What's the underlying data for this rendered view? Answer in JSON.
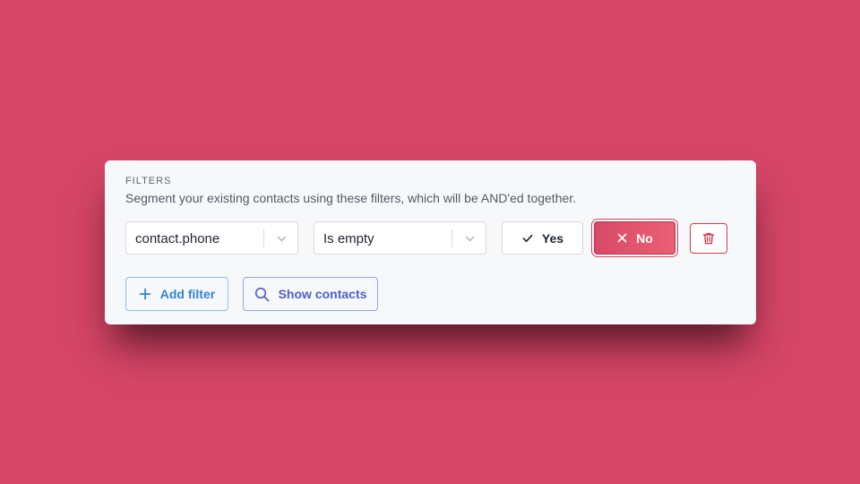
{
  "filters": {
    "section_label": "FILTERS",
    "description": "Segment your existing contacts using these filters, which will be AND'ed together.",
    "rows": [
      {
        "field_select": {
          "value": "contact.phone"
        },
        "operator_select": {
          "value": "Is empty"
        },
        "yes_label": "Yes",
        "no_label": "No",
        "selected": "No"
      }
    ],
    "actions": {
      "add_filter_label": "Add filter",
      "show_contacts_label": "Show contacts"
    }
  },
  "colors": {
    "background": "#d54566",
    "card": "#f7f8fa",
    "active_toggle": "#e05570",
    "delete_border": "#cf3b4e",
    "add_filter_accent": "#2e86d6",
    "show_contacts_accent": "#4c5fd0"
  },
  "icons": {
    "select_chevron": "chevron-down-icon",
    "yes": "check-icon",
    "no": "x-icon",
    "delete": "trash-icon",
    "add": "plus-icon",
    "show": "search-icon"
  }
}
